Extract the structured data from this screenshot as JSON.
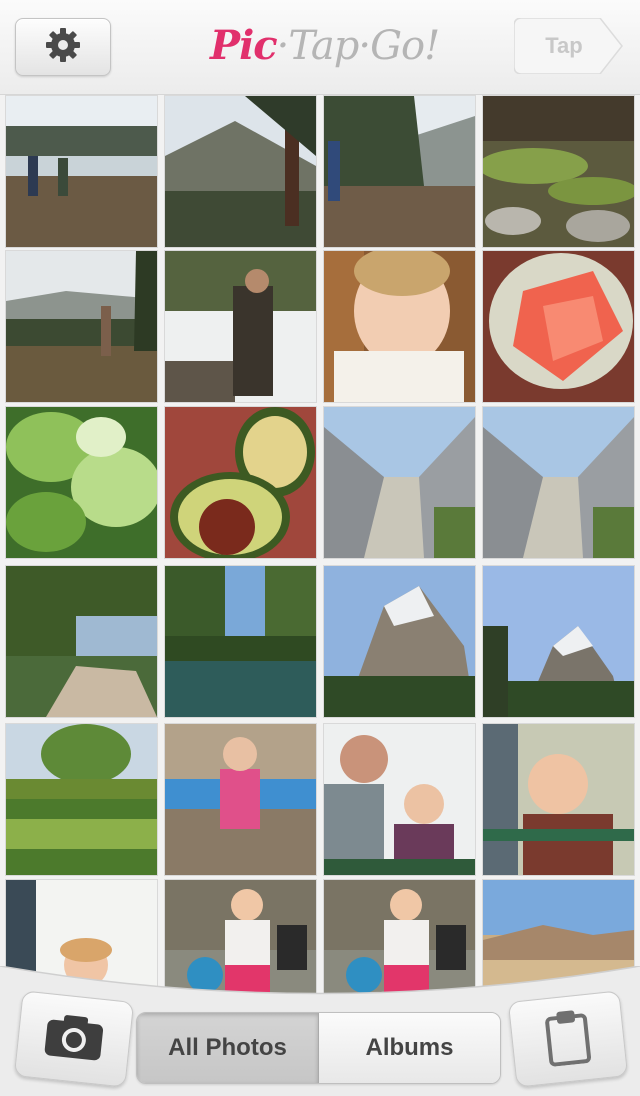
{
  "header": {
    "logo": {
      "part1": "Pic",
      "part2": "·Tap·Go!"
    },
    "tap_label": "Tap",
    "settings_icon": "gear-icon"
  },
  "grid": {
    "columns": 4,
    "rows": 6,
    "photos": [
      "hikers-lake",
      "mountain-valley",
      "hiker-trail",
      "mossy-rocks",
      "pine-meadow",
      "hiker-snow",
      "baby-portrait",
      "grapefruit-bowl",
      "lettuce",
      "avocado",
      "parking-garage",
      "parking-garage-2",
      "tree-river",
      "river",
      "snowy-peak",
      "snowy-peak-2",
      "garden",
      "toddler-bench",
      "ride-dad-son",
      "ride-boy",
      "child-sky",
      "toddler-planter",
      "toddler-planter-2",
      "desert-hills"
    ]
  },
  "bottom": {
    "camera_icon": "camera-icon",
    "clipboard_icon": "clipboard-icon",
    "tabs": [
      {
        "label": "All Photos",
        "active": true
      },
      {
        "label": "Albums",
        "active": false
      }
    ]
  },
  "colors": {
    "logo_accent": "#e1306c",
    "logo_muted": "#b5b5b5",
    "bar_bg": "#ececec"
  }
}
